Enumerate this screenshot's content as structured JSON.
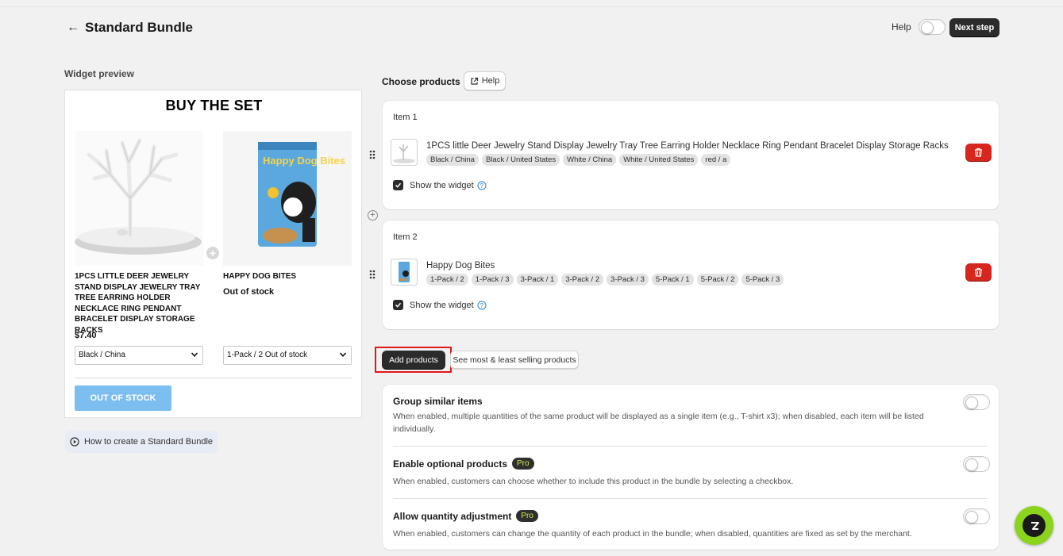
{
  "header": {
    "back_arrow": "←",
    "title": "Standard Bundle",
    "help_label": "Help",
    "help_toggle_on": false,
    "next_step_label": "Next step"
  },
  "preview": {
    "section_label": "Widget preview",
    "heading": "BUY THE SET",
    "products": [
      {
        "name": "1PCS LITTLE DEER JEWELRY STAND DISPLAY JEWELRY TRAY TREE EARRING HOLDER NECKLACE RING PENDANT BRACELET DISPLAY STORAGE RACKS",
        "price": "$7.40",
        "selected_variant": "Black / China",
        "image_icon": "deer-tree-jewelry-stand-image"
      },
      {
        "name": "HAPPY DOG BITES",
        "status": "Out of stock",
        "selected_variant": "1-Pack / 2 Out of stock",
        "image_icon": "dog-food-bag-image",
        "package_text": "Happy Dog Bites"
      }
    ],
    "button_label": "OUT OF STOCK",
    "howto_label": "How to create a Standard Bundle"
  },
  "choose": {
    "section_label": "Choose products",
    "help_label": "Help",
    "items": [
      {
        "title": "Item 1",
        "name": "1PCS little Deer Jewelry Stand Display Jewelry Tray Tree Earring Holder Necklace Ring Pendant Bracelet Display Storage Racks",
        "variants": [
          "Black / China",
          "Black / United States",
          "White / China",
          "White / United States",
          "red / a"
        ],
        "show_widget_label": "Show the widget",
        "show_widget_checked": true
      },
      {
        "title": "Item 2",
        "name": "Happy Dog Bites",
        "variants": [
          "1-Pack / 2",
          "1-Pack / 3",
          "3-Pack / 1",
          "3-Pack / 2",
          "3-Pack / 3",
          "5-Pack / 1",
          "5-Pack / 2",
          "5-Pack / 3"
        ],
        "show_widget_label": "Show the widget",
        "show_widget_checked": true
      }
    ],
    "add_products_label": "Add products",
    "see_selling_label": "See most & least selling products"
  },
  "settings": [
    {
      "title": "Group similar items",
      "pro": false,
      "description": "When enabled, multiple quantities of the same product will be displayed as a single item (e.g., T-shirt x3); when disabled, each item will be listed individually.",
      "enabled": false
    },
    {
      "title": "Enable optional products",
      "pro": true,
      "pro_label": "Pro",
      "description": "When enabled, customers can choose whether to include this product in the bundle by selecting a checkbox.",
      "enabled": false
    },
    {
      "title": "Allow quantity adjustment",
      "pro": true,
      "pro_label": "Pro",
      "description": "When enabled, customers can change the quantity of each product in the bundle; when disabled, quantities are fixed as set by the merchant.",
      "enabled": false
    }
  ],
  "colors": {
    "primary_button": "#2b2b2b",
    "delete_button": "#d7261e",
    "out_of_stock_button": "#7dbef0",
    "highlight_border": "#e0191a",
    "pro_badge_text": "#d6e74a",
    "fab": "#8ad41e"
  }
}
